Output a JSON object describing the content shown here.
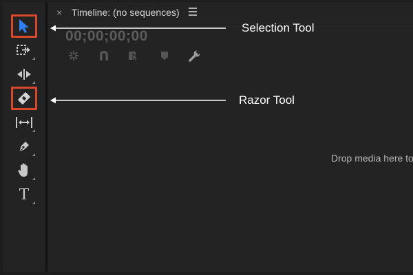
{
  "timeline": {
    "title": "Timeline: (no sequences)",
    "close_glyph": "×",
    "timecode": "00;00;00;00",
    "drop_hint": "Drop media here to",
    "buttons": [
      "insert-nested-icon",
      "snap-magnet-icon",
      "linked-selection-icon",
      "add-marker-icon",
      "wrench-icon"
    ]
  },
  "tools": [
    {
      "name": "selection-tool",
      "icon": "arrow-pointer-icon",
      "highlighted": true
    },
    {
      "name": "track-select-tool",
      "icon": "track-select-forward-icon"
    },
    {
      "name": "ripple-edit-tool",
      "icon": "ripple-edit-icon"
    },
    {
      "name": "razor-tool",
      "icon": "razor-blade-icon",
      "highlighted": true
    },
    {
      "name": "slip-tool",
      "icon": "slip-icon"
    },
    {
      "name": "pen-tool",
      "icon": "pen-icon"
    },
    {
      "name": "hand-tool",
      "icon": "hand-icon"
    },
    {
      "name": "type-tool",
      "icon": "type-icon",
      "glyph": "T"
    }
  ],
  "annotations": {
    "selection_label": "Selection Tool",
    "razor_label": "Razor Tool"
  },
  "colors": {
    "highlight_box": "#d9482b",
    "selection_arrow": "#2f80f0",
    "background": "#1d1d1d",
    "panel": "#232323",
    "annotation_text": "#ffffff"
  }
}
